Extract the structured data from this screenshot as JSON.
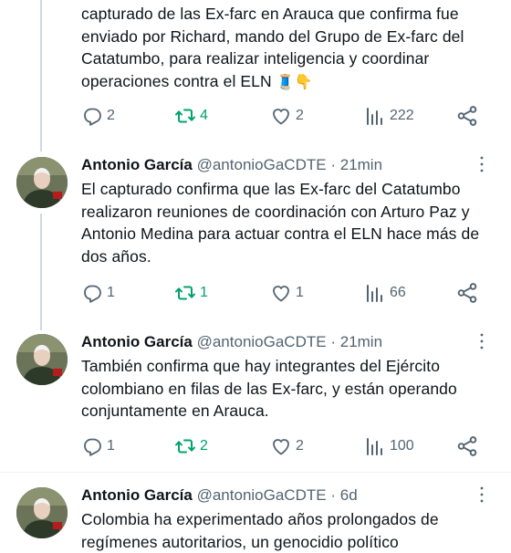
{
  "colors": {
    "text": "#0f1419",
    "muted": "#536471",
    "retweet": "#00a36c",
    "thread": "#cfd9de"
  },
  "tweets": [
    {
      "name": "",
      "handle": "",
      "time": "",
      "text": "capturado de las Ex-farc en Arauca que confirma fue enviado por Richard, mando del Grupo de Ex-farc del Catatumbo, para realizar inteligencia y coordinar operaciones contra el ELN",
      "emoji": "🧵👇",
      "replies": "2",
      "retweets": "4",
      "likes": "2",
      "views": "222"
    },
    {
      "name": "Antonio García",
      "handle": "@antonioGaCDTE",
      "sep": "·",
      "time": "21min",
      "text": "El capturado confirma que las Ex-farc del Catatumbo realizaron reuniones de coordinación con Arturo Paz y Antonio Medina para actuar contra el ELN hace más de dos años.",
      "replies": "1",
      "retweets": "1",
      "likes": "1",
      "views": "66"
    },
    {
      "name": "Antonio García",
      "handle": "@antonioGaCDTE",
      "sep": "·",
      "time": "21min",
      "text": "También confirma que hay integrantes del Ejército colombiano en filas de las Ex-farc, y están operando conjuntamente en Arauca.",
      "replies": "1",
      "retweets": "2",
      "likes": "2",
      "views": "100"
    },
    {
      "name": "Antonio García",
      "handle": "@antonioGaCDTE",
      "sep": "·",
      "time": "6d",
      "text": "Colombia ha experimentado años prolongados de regímenes autoritarios, un genocidio político"
    }
  ]
}
